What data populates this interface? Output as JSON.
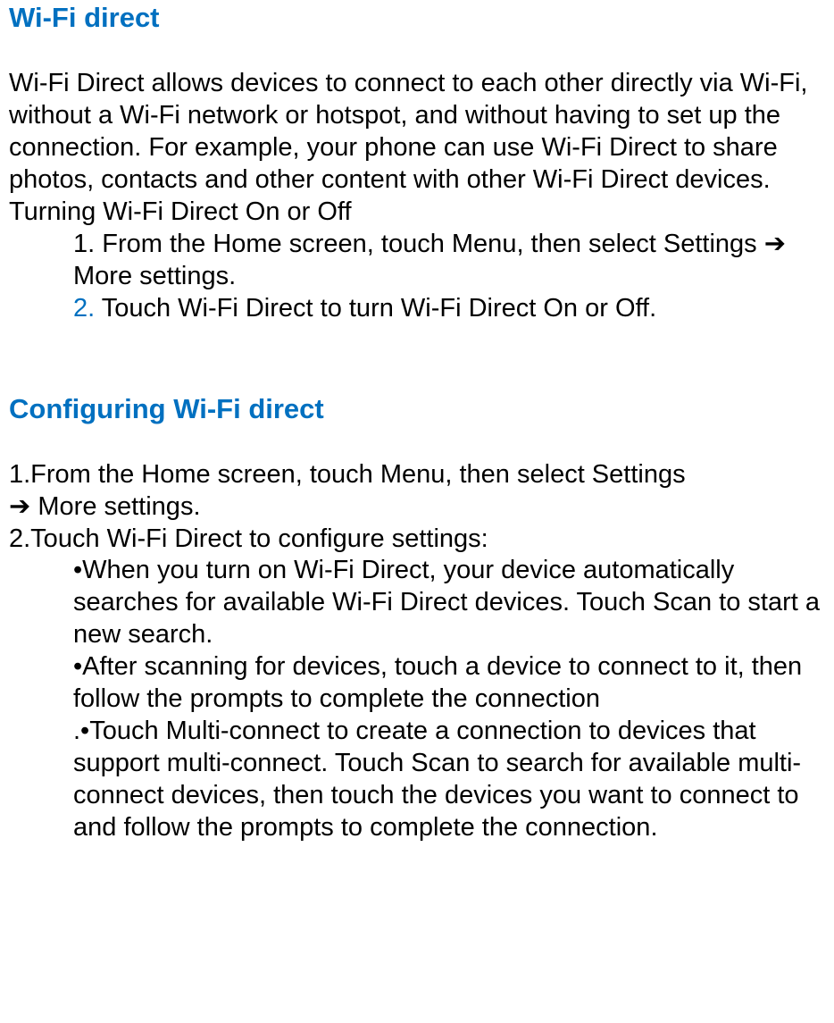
{
  "section1": {
    "title": "Wi-Fi direct",
    "intro": "Wi-Fi Direct allows devices to connect to each other directly via Wi-Fi, without a Wi-Fi network or hotspot, and without having to set up the connection. For example, your phone can use Wi-Fi Direct to share photos, contacts and other content with other Wi-Fi Direct devices.",
    "subhead": "Turning Wi-Fi Direct On or Off",
    "step1_a": "1. From the Home screen, touch Menu, then select Settings  ",
    "step1_arrow": "➔",
    "step1_b": "  More settings.",
    "step2_num": "2.",
    "step2_text": " Touch Wi-Fi Direct    to turn Wi-Fi Direct On or Off."
  },
  "section2": {
    "title": "Configuring Wi-Fi direct",
    "step1_a": "1.From the Home screen, touch    Menu, then select Settings ",
    "step1_arrow": "➔",
    "step1_b": "  More settings.",
    "step2": "2.Touch Wi-Fi Direct to configure settings:",
    "bullet1": "•When you turn on Wi-Fi Direct, your device automatically    searches for available Wi-Fi Direct devices. Touch Scan to start a new search.",
    "bullet2": "•After scanning for devices, touch a device to connect to it, then follow the prompts to complete the connection",
    "bullet3": ".•Touch Multi-connect to create a connection to devices that support multi-connect. Touch Scan to search for available multi-connect devices, then touch the devices you want to connect to and follow the prompts to complete the connection."
  }
}
